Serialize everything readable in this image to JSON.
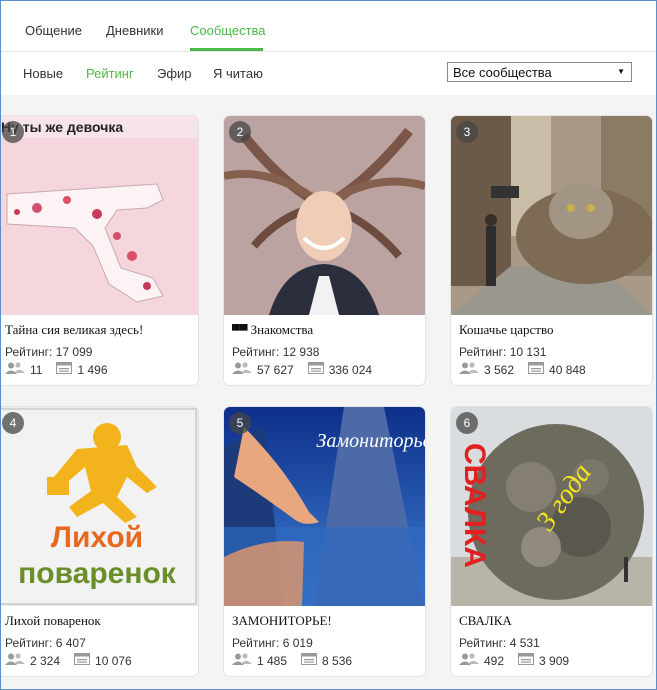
{
  "top_tabs": [
    "Общение",
    "Дневники",
    "Сообщества"
  ],
  "active_top_tab": "Сообщества",
  "sub_tabs": [
    "Новые",
    "Рейтинг",
    "Эфир",
    "Я читаю"
  ],
  "active_sub_tab": "Рейтинг",
  "filter": {
    "selected": "Все сообщества"
  },
  "labels": {
    "rating_prefix": "Рейтинг:"
  },
  "cards": [
    {
      "rank": "1",
      "title": "Тайна сия великая здесь!",
      "rating": "17 099",
      "members": "11",
      "posts": "1 496",
      "image_caption": "Ну ты же девочка"
    },
    {
      "rank": "2",
      "title": "Знакомства",
      "rating": "12 938",
      "members": "57 627",
      "posts": "336 024",
      "badge_icon": "glasses-icon"
    },
    {
      "rank": "3",
      "title": "Кошачье царство",
      "rating": "10 131",
      "members": "3 562",
      "posts": "40 848"
    },
    {
      "rank": "4",
      "title": "Лихой поваренок",
      "rating": "6 407",
      "members": "2 324",
      "posts": "10 076",
      "logo_line1": "Лихой",
      "logo_line2": "поваренок"
    },
    {
      "rank": "5",
      "title": "ЗАМОНИТОРЬЕ!",
      "rating": "6 019",
      "members": "1 485",
      "posts": "8 536",
      "image_caption": "Замониторье"
    },
    {
      "rank": "6",
      "title": "СВАЛКА",
      "rating": "4 531",
      "members": "492",
      "posts": "3 909",
      "image_caption": "СВАЛКА",
      "image_caption2": "3 года"
    }
  ],
  "colors": {
    "accent": "#4cb848",
    "frame": "#5b8fc9"
  }
}
